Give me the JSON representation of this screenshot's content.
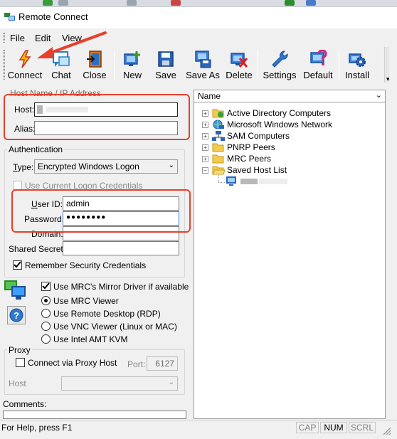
{
  "window": {
    "title": "Remote Connect"
  },
  "menu": [
    "File",
    "Edit",
    "View"
  ],
  "toolbar": [
    {
      "label": "Connect",
      "icon": "lightning-icon"
    },
    {
      "label": "Chat",
      "icon": "chat-icon"
    },
    {
      "label": "Close",
      "icon": "exit-door-icon"
    },
    {
      "label": "New",
      "icon": "new-plus-icon"
    },
    {
      "label": "Save",
      "icon": "floppy-disk-icon"
    },
    {
      "label": "Save As",
      "icon": "save-as-icon"
    },
    {
      "label": "Delete",
      "icon": "delete-x-icon"
    },
    {
      "label": "Settings",
      "icon": "wrench-icon"
    },
    {
      "label": "Default",
      "icon": "question-default-icon"
    },
    {
      "label": "Install",
      "icon": "gear-install-icon"
    }
  ],
  "host_section": {
    "title": "Host Name / IP Address",
    "host_label": "Host:",
    "host_value": "",
    "alias_label": "Alias:",
    "alias_value": ""
  },
  "auth": {
    "title": "Authentication",
    "type_label": "Type:",
    "type_value": "Encrypted Windows Logon",
    "current_logon_label": "Use Current Logon Credentials",
    "userid_label": "User ID:",
    "userid_value": "admin",
    "password_label": "Password:",
    "password_value": "●●●●●●●●",
    "domain_label": "Domain:",
    "domain_value": "",
    "shared_secret_label": "Shared Secret:",
    "shared_secret_value": "",
    "remember_label": "Remember Security Credentials"
  },
  "viewer": {
    "mirror_label": "Use MRC's Mirror Driver if available",
    "options": [
      "Use MRC Viewer",
      "Use Remote Desktop (RDP)",
      "Use VNC Viewer (Linux or MAC)",
      "Use Intel AMT KVM"
    ],
    "selected": "Use MRC Viewer"
  },
  "proxy": {
    "title": "Proxy",
    "connect_label": "Connect via Proxy Host",
    "port_label": "Port:",
    "port_value": "6127",
    "host_label": "Host"
  },
  "comments_label": "Comments:",
  "tree": {
    "header": "Name",
    "items": [
      "Active Directory Computers",
      "Microsoft Windows Network",
      "SAM Computers",
      "PNRP Peers",
      "MRC Peers",
      "Saved Host List"
    ]
  },
  "status": {
    "help_text": "For Help, press F1",
    "caps": "CAP",
    "num": "NUM",
    "scroll": "SCRL"
  },
  "colors": {
    "highlight_box": "#e8402a",
    "arrow": "#e8402a"
  }
}
